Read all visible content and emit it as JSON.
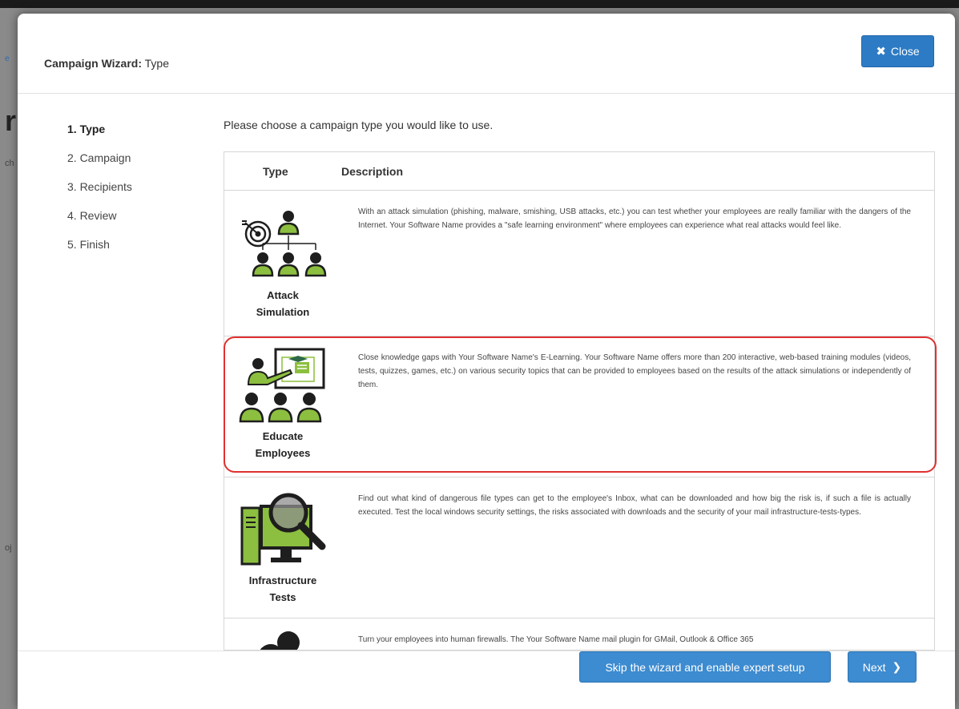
{
  "background": {
    "glyph_big": "r",
    "glyph_dot": "e",
    "glyph_s1": "ch",
    "glyph_s2": "oj"
  },
  "modal": {
    "title_prefix": "Campaign Wizard:",
    "title_step": "Type",
    "close_label": "Close",
    "close_icon": "times-icon"
  },
  "steps": [
    "1. Type",
    "2. Campaign",
    "3. Recipients",
    "4. Review",
    "5. Finish"
  ],
  "active_step": 0,
  "intro": "Please choose a campaign type you would like to use.",
  "table": {
    "headers": {
      "type": "Type",
      "description": "Description"
    },
    "rows": [
      {
        "label_line1": "Attack",
        "label_line2": "Simulation",
        "icon": "attack-simulation-icon",
        "description": "With an attack simulation (phishing, malware, smishing, USB attacks, etc.) you can test whether your employees are really familiar with the dangers of the Internet. Your Software Name provides a \"safe learning environment\" where employees can experience what real attacks would feel like."
      },
      {
        "label_line1": "Educate",
        "label_line2": "Employees",
        "icon": "educate-employees-icon",
        "description": "Close knowledge gaps with Your Software Name's E-Learning. Your Software Name offers more than 200 interactive, web-based training modules (videos, tests, quizzes, games, etc.) on various security topics that can be provided to employees based on the results of the attack simulations or independently of them."
      },
      {
        "label_line1": "Infrastructure",
        "label_line2": "Tests",
        "icon": "infrastructure-tests-icon",
        "description": "Find out what kind of dangerous file types can get to the employee's Inbox, what can be downloaded and how big the risk is, if such a file is actually executed. Test the local windows security settings, the risks associated with downloads and the security of your mail infrastructure-tests-types."
      },
      {
        "label_line1": "",
        "label_line2": "",
        "icon": "human-firewall-icon",
        "description": "Turn your employees into human firewalls. The Your Software Name mail plugin for GMail, Outlook & Office 365"
      }
    ]
  },
  "footer": {
    "skip_label": "Skip the wizard and enable expert setup",
    "next_label": "Next",
    "next_icon": "chevron-right-icon"
  },
  "colors": {
    "primary_button": "#3d8bd0",
    "highlight_border": "#e03030",
    "icon_green": "#8cbf3f",
    "icon_dark": "#1e1e1e"
  }
}
